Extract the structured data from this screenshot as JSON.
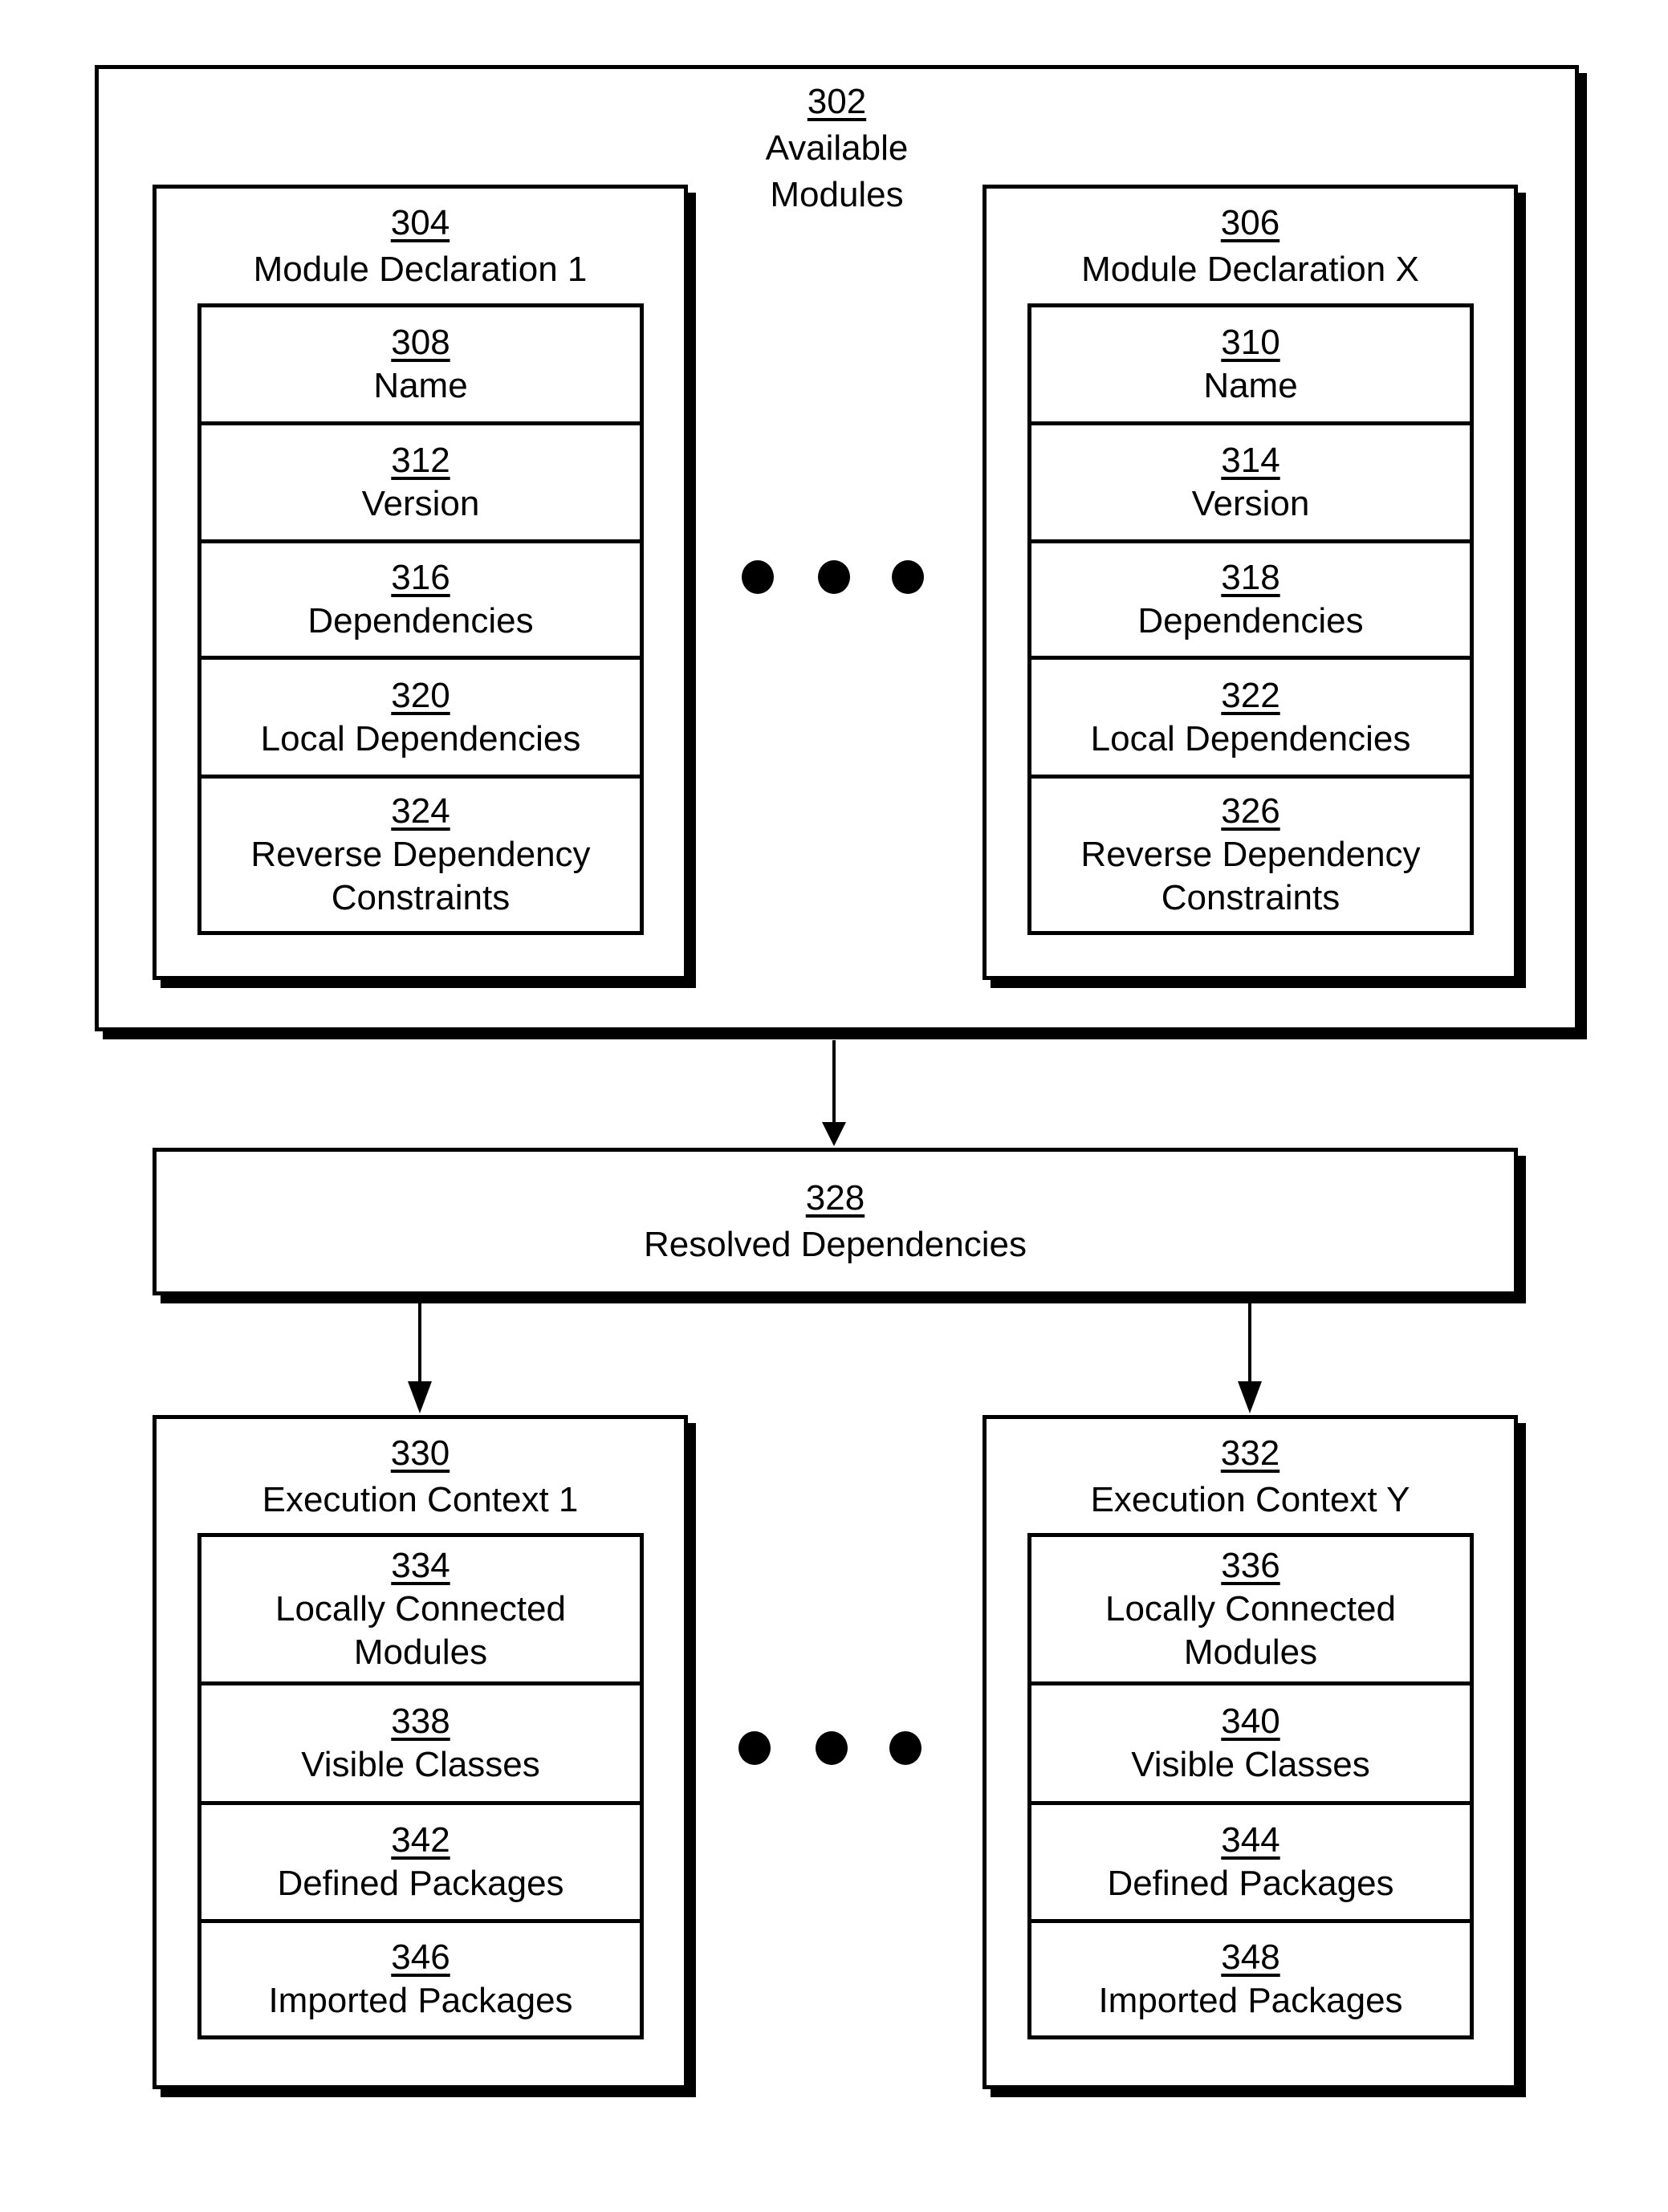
{
  "available_modules": {
    "ref": "302",
    "label_line1": "Available",
    "label_line2": "Modules",
    "declarations": [
      {
        "ref": "304",
        "label": "Module Declaration 1",
        "fields": [
          {
            "ref": "308",
            "label": "Name"
          },
          {
            "ref": "312",
            "label": "Version"
          },
          {
            "ref": "316",
            "label": "Dependencies"
          },
          {
            "ref": "320",
            "label": "Local Dependencies"
          },
          {
            "ref": "324",
            "label_line1": "Reverse Dependency",
            "label_line2": "Constraints"
          }
        ]
      },
      {
        "ref": "306",
        "label": "Module Declaration X",
        "fields": [
          {
            "ref": "310",
            "label": "Name"
          },
          {
            "ref": "314",
            "label": "Version"
          },
          {
            "ref": "318",
            "label": "Dependencies"
          },
          {
            "ref": "322",
            "label": "Local Dependencies"
          },
          {
            "ref": "326",
            "label_line1": "Reverse Dependency",
            "label_line2": "Constraints"
          }
        ]
      }
    ]
  },
  "resolved_dependencies": {
    "ref": "328",
    "label": "Resolved Dependencies"
  },
  "execution_contexts": [
    {
      "ref": "330",
      "label": "Execution Context 1",
      "fields": [
        {
          "ref": "334",
          "label_line1": "Locally Connected",
          "label_line2": "Modules"
        },
        {
          "ref": "338",
          "label": "Visible Classes"
        },
        {
          "ref": "342",
          "label": "Defined Packages"
        },
        {
          "ref": "346",
          "label": "Imported Packages"
        }
      ]
    },
    {
      "ref": "332",
      "label": "Execution Context Y",
      "fields": [
        {
          "ref": "336",
          "label_line1": "Locally Connected",
          "label_line2": "Modules"
        },
        {
          "ref": "340",
          "label": "Visible Classes"
        },
        {
          "ref": "344",
          "label": "Defined Packages"
        },
        {
          "ref": "348",
          "label": "Imported Packages"
        }
      ]
    }
  ]
}
